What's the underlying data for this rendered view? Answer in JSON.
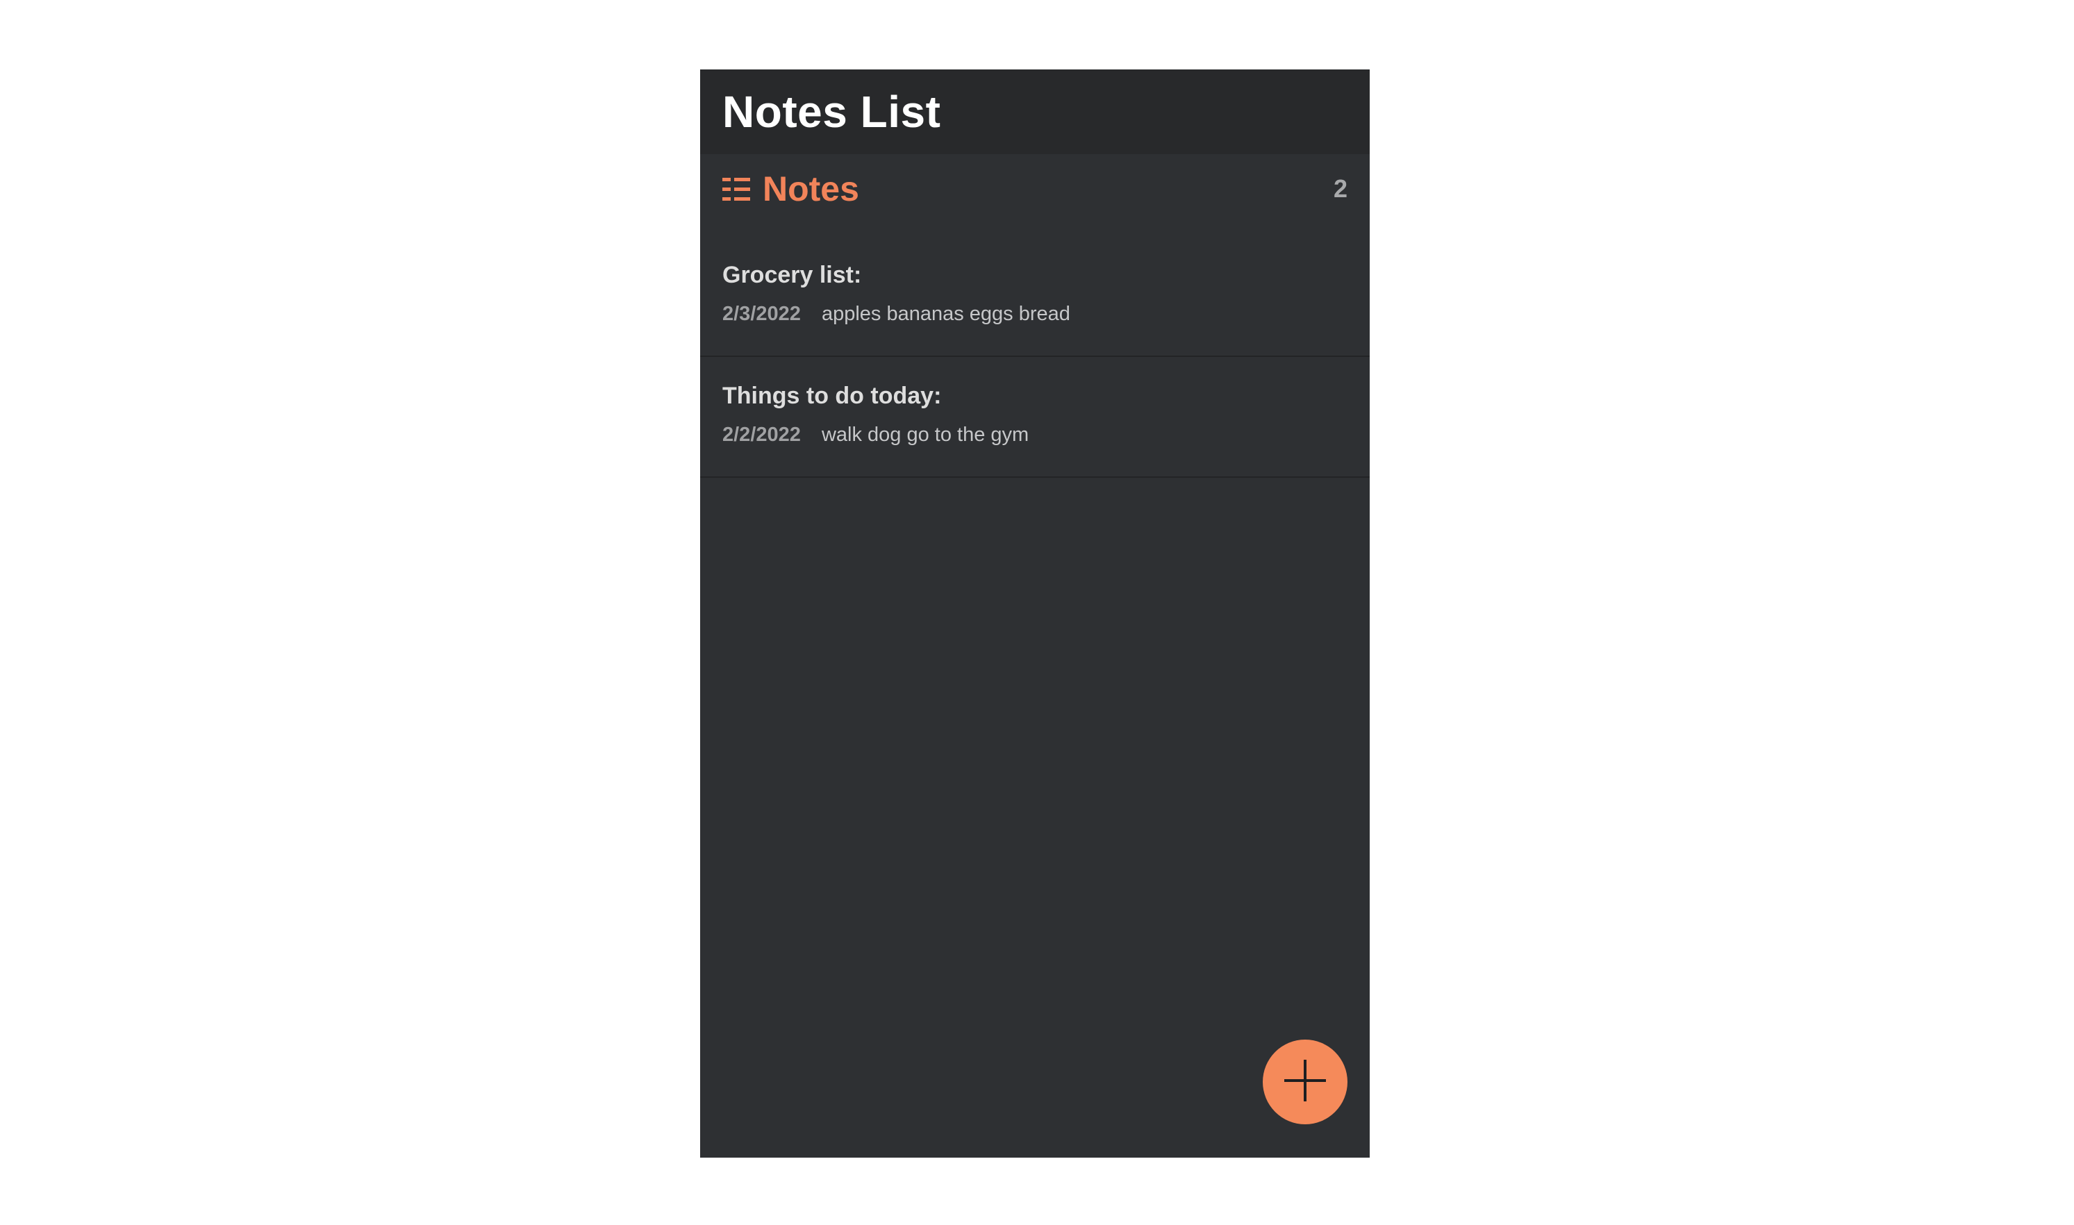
{
  "app": {
    "title": "Notes List"
  },
  "list_header": {
    "icon": "list-icon",
    "title": "Notes",
    "count": "2"
  },
  "notes": [
    {
      "title": "Grocery list:",
      "date": "2/3/2022",
      "preview": "apples bananas eggs bread"
    },
    {
      "title": "Things to do today:",
      "date": "2/2/2022",
      "preview": "walk dog go to the gym"
    }
  ],
  "fab": {
    "icon": "plus-icon"
  },
  "colors": {
    "accent": "#f58a5a",
    "background": "#2e3033",
    "header": "#28292b"
  }
}
